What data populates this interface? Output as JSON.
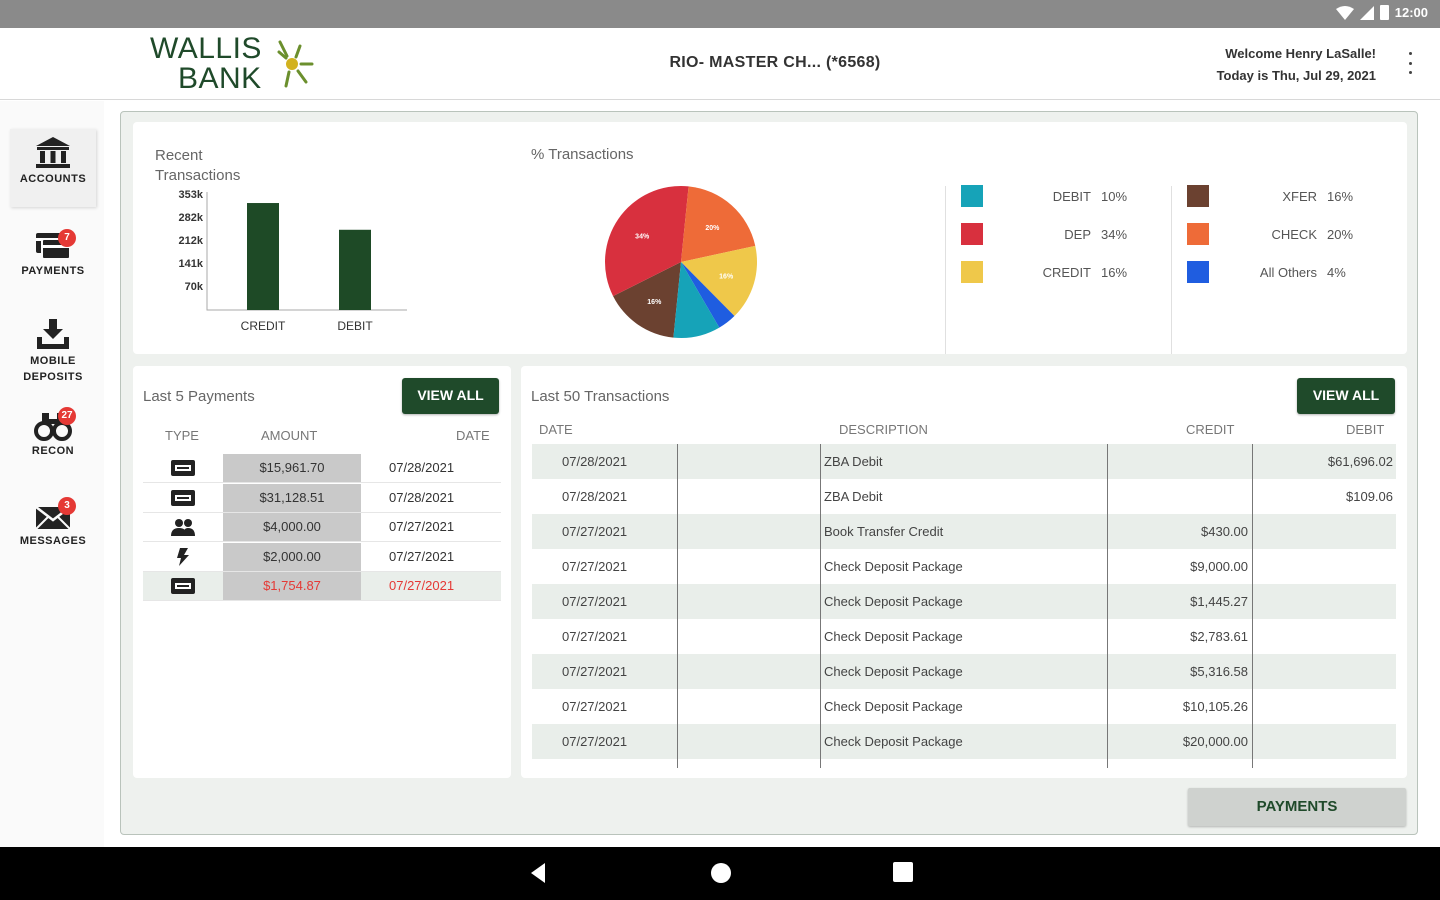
{
  "status_bar": {
    "time": "12:00"
  },
  "header": {
    "logo_line1": "WALLIS",
    "logo_line2": "BANK",
    "account_title": "RIO- MASTER CH...  (*6568)",
    "welcome": "Welcome Henry LaSalle!",
    "date": "Today is Thu, Jul 29, 2021"
  },
  "sidebar": {
    "items": [
      {
        "label": "ACCOUNTS",
        "icon": "bank-icon",
        "badge": ""
      },
      {
        "label": "PAYMENTS",
        "icon": "payments-icon",
        "badge": "7"
      },
      {
        "label": "MOBILE",
        "label2": "DEPOSITS",
        "icon": "mobile-deposit-icon",
        "badge": ""
      },
      {
        "label": "RECON",
        "icon": "binoculars-icon",
        "badge": "27"
      },
      {
        "label": "MESSAGES",
        "icon": "envelope-icon",
        "badge": "3"
      }
    ]
  },
  "recent_transactions": {
    "title": "Recent Transactions"
  },
  "chart_data": [
    {
      "type": "bar",
      "title": "Recent Transactions",
      "categories": [
        "CREDIT",
        "DEBIT"
      ],
      "values": [
        320000,
        240000
      ],
      "y_tick_labels": [
        "353k",
        "282k",
        "212k",
        "141k",
        "70k"
      ],
      "ylim": [
        0,
        353000
      ],
      "colors": [
        "#1e4a26"
      ]
    },
    {
      "type": "pie",
      "title": "% Transactions",
      "slices": [
        {
          "name": "XFER",
          "value": 16,
          "color": "#6b4130"
        },
        {
          "name": "DEP",
          "value": 34,
          "color": "#d8303e"
        },
        {
          "name": "CHECK",
          "value": 20,
          "color": "#ee6b38"
        },
        {
          "name": "CREDIT",
          "value": 16,
          "color": "#efc84a"
        },
        {
          "name": "All Others",
          "value": 4,
          "color": "#1f5de0"
        },
        {
          "name": "DEBIT",
          "value": 10,
          "color": "#16a3b8"
        }
      ],
      "slice_labels": [
        "16%",
        "34%",
        "20%",
        "16%",
        "",
        ""
      ]
    }
  ],
  "pie_section": {
    "title": "% Transactions"
  },
  "legend": {
    "left": [
      {
        "name": "DEBIT",
        "pct": "10%",
        "color": "#16a3b8"
      },
      {
        "name": "DEP",
        "pct": "34%",
        "color": "#d8303e"
      },
      {
        "name": "CREDIT",
        "pct": "16%",
        "color": "#efc84a"
      }
    ],
    "right": [
      {
        "name": "XFER",
        "pct": "16%",
        "color": "#6b4130"
      },
      {
        "name": "CHECK",
        "pct": "20%",
        "color": "#ee6b38"
      },
      {
        "name": "All Others",
        "pct": "4%",
        "color": "#1f5de0"
      }
    ]
  },
  "payments": {
    "title": "Last 5 Payments",
    "view_all": "VIEW ALL",
    "headers": {
      "type": "TYPE",
      "amount": "AMOUNT",
      "date": "DATE"
    },
    "rows": [
      {
        "type_icon": "ach-icon",
        "amount": "$15,961.70",
        "date": "07/28/2021"
      },
      {
        "type_icon": "ach-icon",
        "amount": "$31,128.51",
        "date": "07/28/2021"
      },
      {
        "type_icon": "people-icon",
        "amount": "$4,000.00",
        "date": "07/27/2021"
      },
      {
        "type_icon": "flash-icon",
        "amount": "$2,000.00",
        "date": "07/27/2021"
      },
      {
        "type_icon": "ach-icon",
        "amount": "$1,754.87",
        "date": "07/27/2021"
      }
    ]
  },
  "transactions": {
    "title": "Last 50 Transactions",
    "view_all": "VIEW ALL",
    "headers": {
      "date": "DATE",
      "description": "DESCRIPTION",
      "credit": "CREDIT",
      "debit": "DEBIT"
    },
    "rows": [
      {
        "date": "07/28/2021",
        "description": "ZBA Debit",
        "credit": "",
        "debit": "$61,696.02"
      },
      {
        "date": "07/28/2021",
        "description": "ZBA Debit",
        "credit": "",
        "debit": "$109.06"
      },
      {
        "date": "07/27/2021",
        "description": "Book Transfer Credit",
        "credit": "$430.00",
        "debit": ""
      },
      {
        "date": "07/27/2021",
        "description": "Check Deposit Package",
        "credit": "$9,000.00",
        "debit": ""
      },
      {
        "date": "07/27/2021",
        "description": "Check Deposit Package",
        "credit": "$1,445.27",
        "debit": ""
      },
      {
        "date": "07/27/2021",
        "description": "Check Deposit Package",
        "credit": "$2,783.61",
        "debit": ""
      },
      {
        "date": "07/27/2021",
        "description": "Check Deposit Package",
        "credit": "$5,316.58",
        "debit": ""
      },
      {
        "date": "07/27/2021",
        "description": "Check Deposit Package",
        "credit": "$10,105.26",
        "debit": ""
      },
      {
        "date": "07/27/2021",
        "description": "Check Deposit Package",
        "credit": "$20,000.00",
        "debit": ""
      }
    ]
  },
  "footer": {
    "payments_button": "PAYMENTS"
  },
  "colors": {
    "brand_green": "#1f4a2a",
    "alert_red": "#e53935"
  }
}
